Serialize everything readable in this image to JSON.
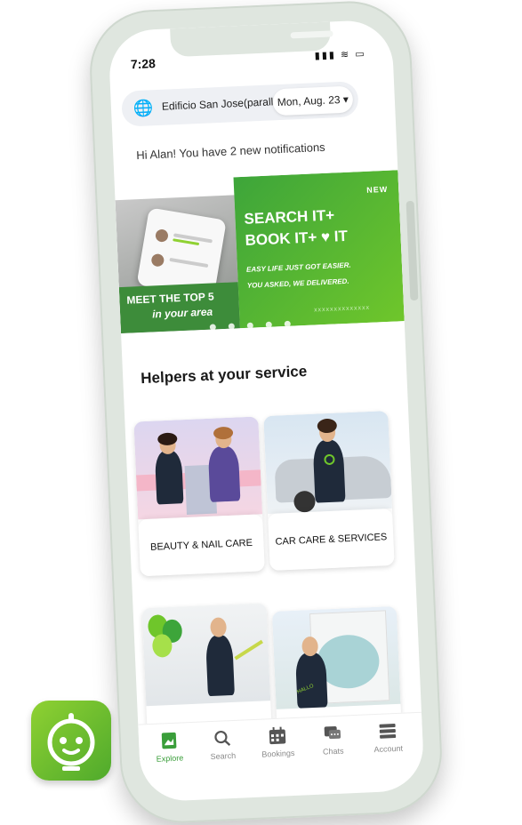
{
  "status": {
    "time": "7:28",
    "icons": "▮▮▮ ≋ ▭"
  },
  "location": {
    "name": "Edificio San Jose(paralle",
    "date": "Mon, Aug. 23 ▾"
  },
  "greeting": "Hi Alan! You have 2 new notifications",
  "banner": {
    "left_line1": "MEET THE TOP 5",
    "left_line2": "in your area",
    "tag": "NEW",
    "headline1": "SEARCH IT+",
    "headline2": "BOOK IT+ ♥ IT",
    "sub1": "EASY LIFE JUST GOT EASIER.",
    "sub2": "YOU ASKED, WE DELIVERED.",
    "pattern": "xxxxxxxxxxxxxx",
    "page_count": 5,
    "active_page": 1
  },
  "section_title": "Helpers at your service",
  "categories": [
    {
      "label": "BEAUTY & NAIL CARE"
    },
    {
      "label": "CAR CARE & SERVICES"
    },
    {
      "label": ""
    },
    {
      "label": ""
    }
  ],
  "illustration_text": {
    "shirt": "HALLO"
  },
  "tabs": [
    {
      "label": "Explore",
      "icon": "explore-icon",
      "active": true
    },
    {
      "label": "Search",
      "icon": "search-icon",
      "active": false
    },
    {
      "label": "Bookings",
      "icon": "calendar-icon",
      "active": false
    },
    {
      "label": "Chats",
      "icon": "chat-icon",
      "active": false
    },
    {
      "label": "Account",
      "icon": "account-icon",
      "active": false
    }
  ],
  "colors": {
    "brand": "#3da53a",
    "brand_light": "#6fc62b",
    "tab_active": "#3a9e3a"
  }
}
